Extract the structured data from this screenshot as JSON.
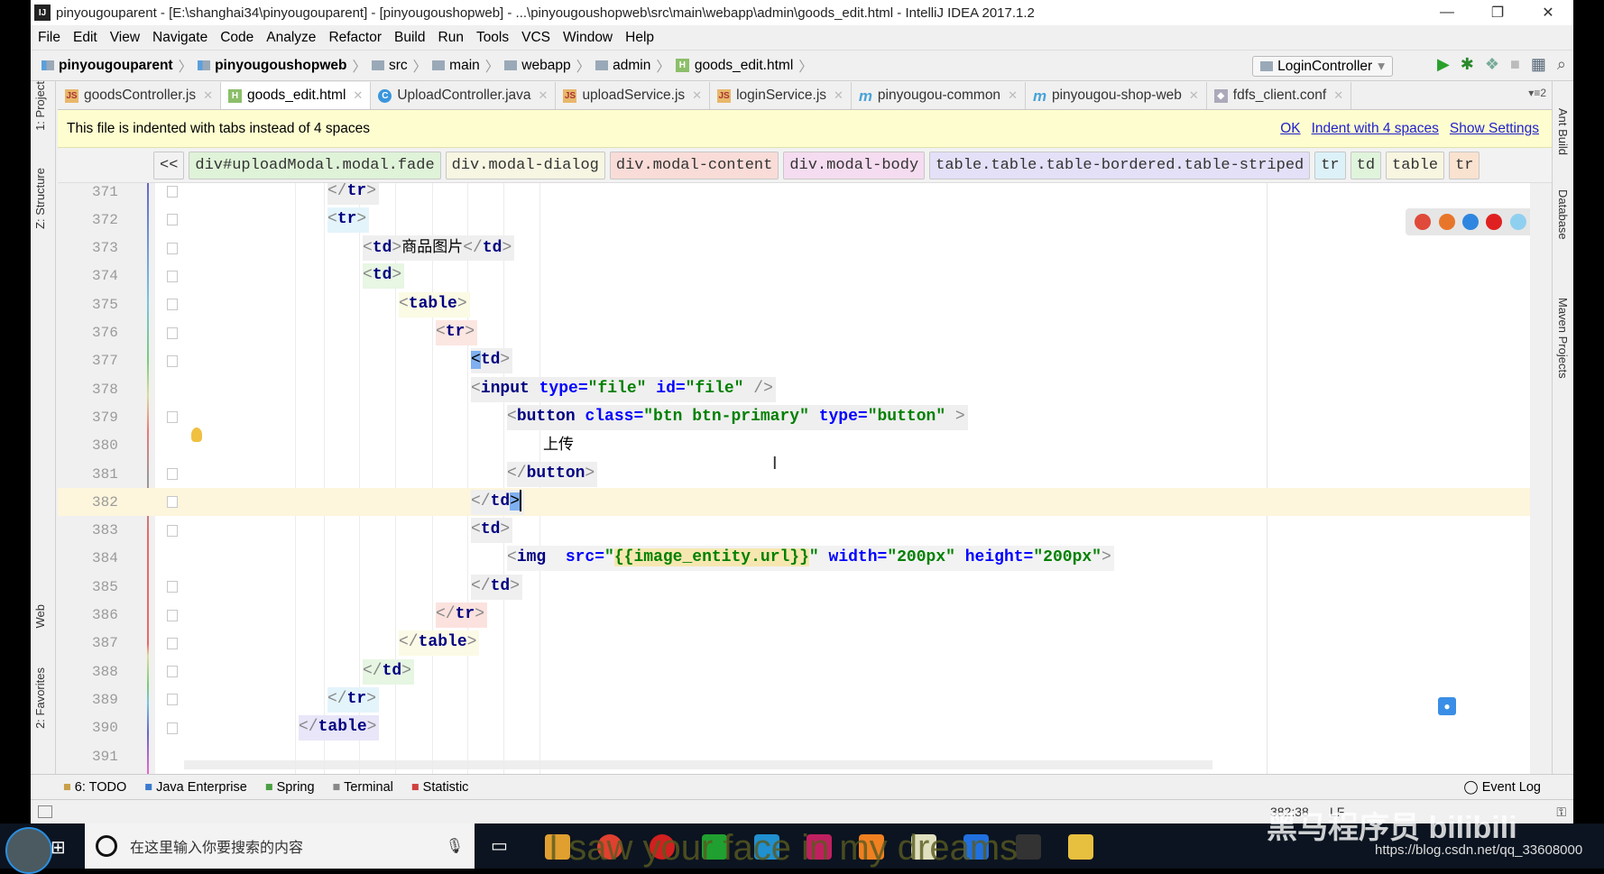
{
  "window": {
    "title": "pinyougouparent - [E:\\shanghai34\\pinyougouparent] - [pinyougoushopweb] - ...\\pinyougoushopweb\\src\\main\\webapp\\admin\\goods_edit.html - IntelliJ IDEA 2017.1.2",
    "app_icon": "IJ",
    "minimize": "—",
    "restore": "❐",
    "close": "✕"
  },
  "menu": [
    "File",
    "Edit",
    "View",
    "Navigate",
    "Code",
    "Analyze",
    "Refactor",
    "Build",
    "Run",
    "Tools",
    "VCS",
    "Window",
    "Help"
  ],
  "breadcrumb": [
    {
      "label": "pinyougouparent",
      "bold": true,
      "icon": "module-folder-icon"
    },
    {
      "label": "pinyougoushopweb",
      "bold": true,
      "icon": "module-folder-icon"
    },
    {
      "label": "src",
      "icon": "folder-icon"
    },
    {
      "label": "main",
      "icon": "folder-icon"
    },
    {
      "label": "webapp",
      "icon": "folder-icon"
    },
    {
      "label": "admin",
      "icon": "folder-icon"
    },
    {
      "label": "goods_edit.html",
      "icon": "html-file-icon"
    }
  ],
  "toolbar": {
    "run_config": "LoginController",
    "icons": [
      "sort-icon",
      "run-icon",
      "debug-icon",
      "coverage-icon",
      "stop-icon",
      "project-structure-icon",
      "search-icon"
    ]
  },
  "tabs": [
    {
      "label": "goodsController.js",
      "icon": "js",
      "active": false
    },
    {
      "label": "goods_edit.html",
      "icon": "h",
      "active": true
    },
    {
      "label": "UploadController.java",
      "icon": "c",
      "active": false
    },
    {
      "label": "uploadService.js",
      "icon": "js",
      "active": false
    },
    {
      "label": "loginService.js",
      "icon": "js",
      "active": false
    },
    {
      "label": "pinyougou-common",
      "icon": "m",
      "active": false
    },
    {
      "label": "pinyougou-shop-web",
      "icon": "m",
      "active": false
    },
    {
      "label": "fdfs_client.conf",
      "icon": "cf",
      "active": false
    }
  ],
  "tabs_more": "▾≡2",
  "left_tools": [
    "1: Project",
    "Z: Structure",
    "Web",
    "2: Favorites"
  ],
  "right_tools": [
    "Ant Build",
    "Database",
    "Maven Projects"
  ],
  "notice": {
    "text": "This file is indented with tabs instead of 4 spaces",
    "ok": "OK",
    "indent": "Indent with 4 spaces",
    "settings": "Show Settings"
  },
  "tag_breadcrumb": {
    "back": "<<",
    "items": [
      {
        "label": "div#uploadModal.modal.fade",
        "color": "#dff3d8"
      },
      {
        "label": "div.modal-dialog",
        "color": "#f6f6e2"
      },
      {
        "label": "div.modal-content",
        "color": "#f9dcd8"
      },
      {
        "label": "div.modal-body",
        "color": "#f5dcf0"
      },
      {
        "label": "table.table.table-bordered.table-striped",
        "color": "#e4e0f8"
      },
      {
        "label": "tr",
        "color": "#dcf2f8"
      },
      {
        "label": "td",
        "color": "#e0f4dc"
      },
      {
        "label": "table",
        "color": "#f8f6e0"
      },
      {
        "label": "tr",
        "color": "#fae2d0"
      }
    ]
  },
  "code": {
    "lines": [
      {
        "n": "371",
        "indent": 1,
        "bg": "#eeeeee",
        "parts": [
          [
            "b",
            "</"
          ],
          [
            "tag",
            "tr"
          ],
          [
            "b",
            ">"
          ]
        ]
      },
      {
        "n": "372",
        "indent": 1,
        "bg": "#e4f4fb",
        "parts": [
          [
            "b",
            "<"
          ],
          [
            "tag",
            "tr"
          ],
          [
            "b",
            ">"
          ]
        ]
      },
      {
        "n": "373",
        "indent": 2,
        "bg": "#efefef",
        "parts": [
          [
            "b",
            "<"
          ],
          [
            "tag",
            "td"
          ],
          [
            "b",
            ">"
          ],
          [
            "txt",
            "商品图片"
          ],
          [
            "b",
            "</"
          ],
          [
            "tag",
            "td"
          ],
          [
            "b",
            ">"
          ]
        ]
      },
      {
        "n": "374",
        "indent": 2,
        "bg": "#e8f6e4",
        "parts": [
          [
            "b",
            "<"
          ],
          [
            "tag",
            "td"
          ],
          [
            "b",
            ">"
          ]
        ]
      },
      {
        "n": "375",
        "indent": 3,
        "bg": "#fbfae4",
        "parts": [
          [
            "b",
            "<"
          ],
          [
            "tag",
            "table"
          ],
          [
            "b",
            ">"
          ]
        ]
      },
      {
        "n": "376",
        "indent": 4,
        "bg": "#fbe6e2",
        "parts": [
          [
            "b",
            "<"
          ],
          [
            "tag",
            "tr"
          ],
          [
            "b",
            ">"
          ]
        ]
      },
      {
        "n": "377",
        "indent": 5,
        "bg": "#efefef",
        "parts": [
          [
            "hl",
            "<"
          ],
          [
            "tag",
            "td"
          ],
          [
            "b",
            ">"
          ]
        ]
      },
      {
        "n": "378",
        "indent": 5,
        "bg": "#efefef",
        "parts": [
          [
            "b",
            "<"
          ],
          [
            "tag",
            "input "
          ],
          [
            "attr",
            "type="
          ],
          [
            "val",
            "\"file\" "
          ],
          [
            "attr",
            "id="
          ],
          [
            "val",
            "\"file\""
          ],
          [
            "b",
            " />"
          ]
        ]
      },
      {
        "n": "379",
        "indent": 6,
        "bg": "#efefef",
        "parts": [
          [
            "b",
            "<"
          ],
          [
            "tag",
            "button "
          ],
          [
            "attr",
            "class="
          ],
          [
            "val",
            "\"btn btn-primary\" "
          ],
          [
            "attr",
            "type="
          ],
          [
            "val",
            "\"button\""
          ],
          [
            "b",
            " >"
          ]
        ]
      },
      {
        "n": "380",
        "indent": 7,
        "bg": "",
        "parts": [
          [
            "txt",
            "上传"
          ]
        ]
      },
      {
        "n": "381",
        "indent": 6,
        "bg": "#efefef",
        "parts": [
          [
            "b",
            "</"
          ],
          [
            "tag",
            "button"
          ],
          [
            "b",
            ">"
          ]
        ]
      },
      {
        "n": "382",
        "indent": 5,
        "bg": "#efefef",
        "caret": true,
        "parts": [
          [
            "b",
            "</"
          ],
          [
            "tag",
            "td"
          ],
          [
            "hl",
            ">"
          ]
        ]
      },
      {
        "n": "383",
        "indent": 5,
        "bg": "#efefef",
        "parts": [
          [
            "b",
            "<"
          ],
          [
            "tag",
            "td"
          ],
          [
            "b",
            ">"
          ]
        ]
      },
      {
        "n": "384",
        "indent": 6,
        "bg": "#f2f2f2",
        "parts": [
          [
            "b",
            "<"
          ],
          [
            "tag",
            "img  "
          ],
          [
            "attr",
            "src="
          ],
          [
            "val",
            "\""
          ],
          [
            "exp",
            "{{image_entity.url}}"
          ],
          [
            "val",
            "\" "
          ],
          [
            "attr",
            "width="
          ],
          [
            "val",
            "\"200px\" "
          ],
          [
            "attr",
            "height="
          ],
          [
            "val",
            "\"200px\""
          ],
          [
            "b",
            ">"
          ]
        ]
      },
      {
        "n": "385",
        "indent": 5,
        "bg": "#efefef",
        "parts": [
          [
            "b",
            "</"
          ],
          [
            "tag",
            "td"
          ],
          [
            "b",
            ">"
          ]
        ]
      },
      {
        "n": "386",
        "indent": 4,
        "bg": "#fbe2de",
        "parts": [
          [
            "b",
            "</"
          ],
          [
            "tag",
            "tr"
          ],
          [
            "b",
            ">"
          ]
        ]
      },
      {
        "n": "387",
        "indent": 3,
        "bg": "#fbfae6",
        "parts": [
          [
            "b",
            "</"
          ],
          [
            "tag",
            "table"
          ],
          [
            "b",
            ">"
          ]
        ]
      },
      {
        "n": "388",
        "indent": 2,
        "bg": "#e6f6e2",
        "parts": [
          [
            "b",
            "</"
          ],
          [
            "tag",
            "td"
          ],
          [
            "b",
            ">"
          ]
        ]
      },
      {
        "n": "389",
        "indent": 1,
        "bg": "#e4f4fb",
        "parts": [
          [
            "b",
            "</"
          ],
          [
            "tag",
            "tr"
          ],
          [
            "b",
            ">"
          ]
        ]
      },
      {
        "n": "390",
        "indent": 0,
        "bg": "#e8e6f8",
        "parts": [
          [
            "b",
            "</"
          ],
          [
            "tag",
            "table"
          ],
          [
            "b",
            ">"
          ]
        ]
      },
      {
        "n": "391",
        "indent": 0,
        "bg": "",
        "parts": []
      }
    ]
  },
  "browsers": [
    {
      "name": "chrome-icon",
      "color": "#e04a3a"
    },
    {
      "name": "firefox-icon",
      "color": "#e8762a"
    },
    {
      "name": "safari-icon",
      "color": "#2f86e0"
    },
    {
      "name": "opera-icon",
      "color": "#e02020"
    },
    {
      "name": "ie-icon",
      "color": "#8fd0f0"
    }
  ],
  "tool_windows": [
    "6: TODO",
    "Java Enterprise",
    "Spring",
    "Terminal",
    "Statistic"
  ],
  "event_log": "Event Log",
  "status": {
    "position": "382:38",
    "line_sep": "LF"
  },
  "taskbar": {
    "search_placeholder": "在这里输入你要搜索的内容"
  },
  "overlay": {
    "lyric": "I saw your face in my dreams",
    "watermark": "黑马程序员 bilibili",
    "url": "https://blog.csdn.net/qq_33608000"
  }
}
